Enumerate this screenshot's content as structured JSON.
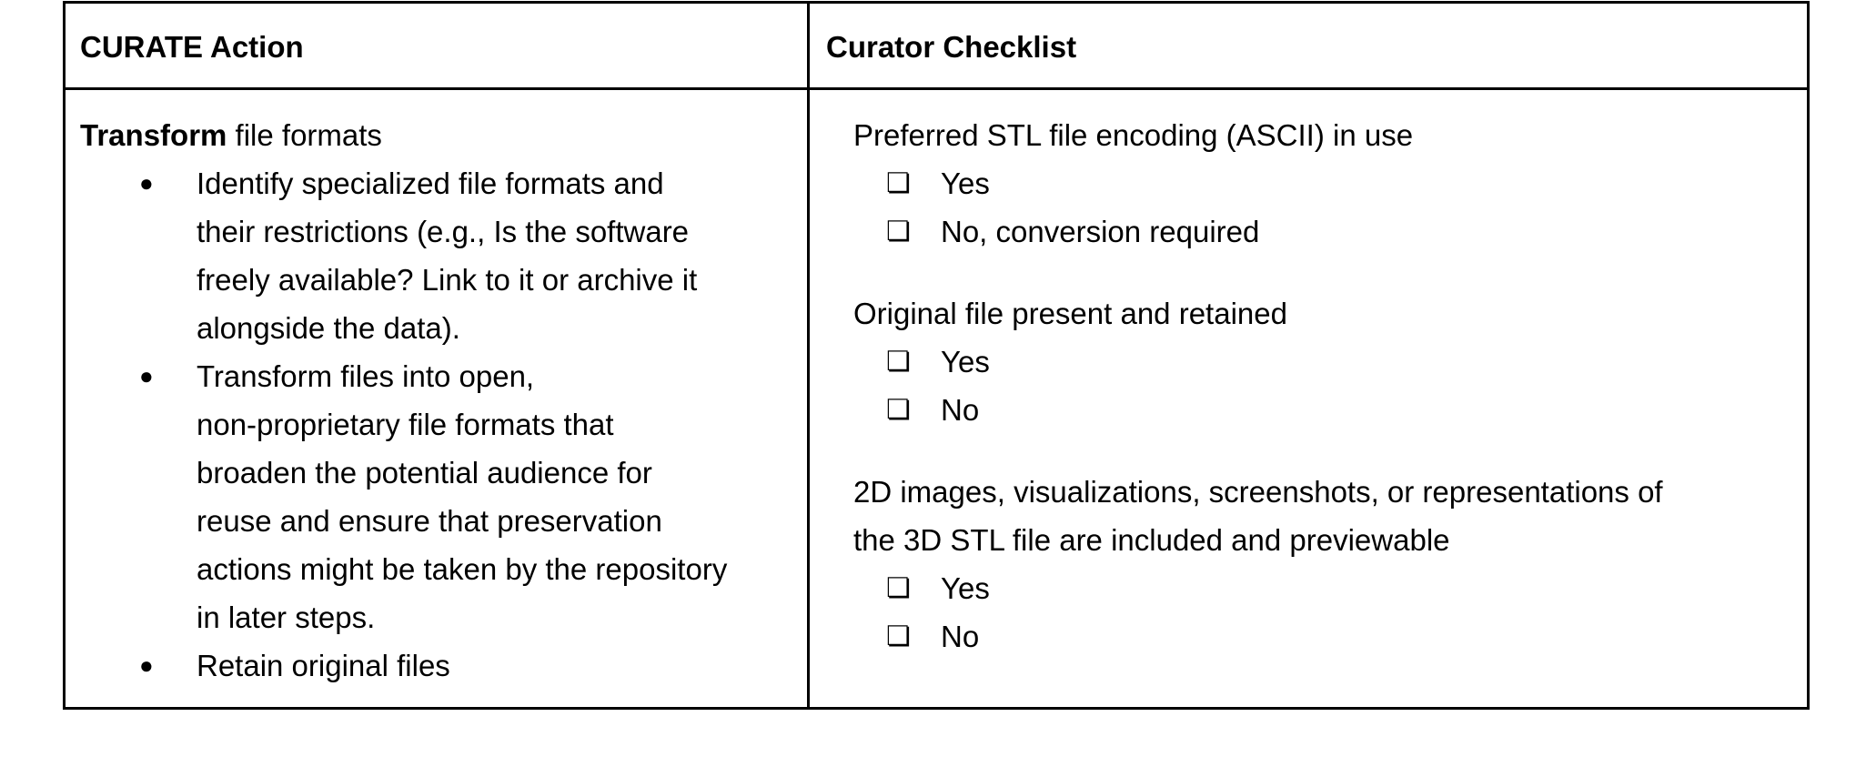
{
  "table": {
    "headers": {
      "left": "CURATE Action",
      "right": "Curator Checklist"
    },
    "action": {
      "lead_bold": "Transform",
      "lead_rest": " file formats",
      "bullets": [
        {
          "lines": [
            "Identify specialized file formats and",
            "their restrictions (e.g., Is the software",
            "freely available? Link to it or archive it",
            "alongside the data)."
          ]
        },
        {
          "lines": [
            "Transform files into open,",
            "non-proprietary file formats that",
            "broaden the potential audience for",
            "reuse and ensure that preservation",
            "actions might be taken by the repository",
            "in later steps."
          ]
        },
        {
          "lines": [
            "Retain original files"
          ]
        }
      ]
    },
    "checklist": [
      {
        "question_lines": [
          "Preferred STL file encoding (ASCII) in use"
        ],
        "options": [
          "Yes",
          "No, conversion required"
        ]
      },
      {
        "question_lines": [
          "Original file present and retained"
        ],
        "options": [
          "Yes",
          "No"
        ]
      },
      {
        "question_lines": [
          "2D images, visualizations, screenshots, or representations of",
          "the 3D STL file are included and previewable"
        ],
        "options": [
          "Yes",
          "No"
        ]
      }
    ]
  },
  "icons": {
    "bullet": "bullet-dot-icon",
    "checkbox": "checkbox-icon"
  }
}
